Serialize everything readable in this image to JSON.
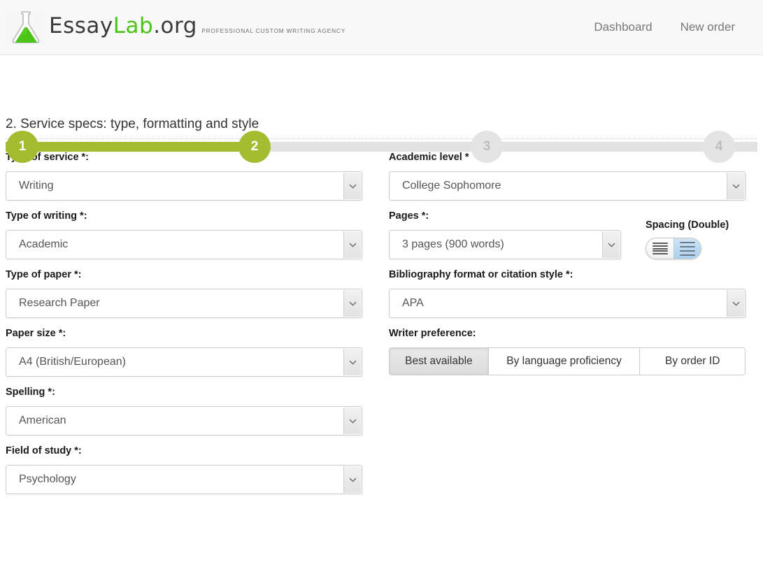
{
  "header": {
    "logo": {
      "icon": "flask-icon",
      "name_part1": "Essay",
      "name_part2": "Lab",
      "name_part3": ".org",
      "tagline": "PROFESSIONAL CUSTOM WRITING AGENCY"
    },
    "nav": [
      {
        "label": "Dashboard"
      },
      {
        "label": "New order"
      }
    ]
  },
  "stepper": {
    "steps": [
      {
        "number": "1",
        "state": "active"
      },
      {
        "number": "2",
        "state": "active"
      },
      {
        "number": "3",
        "state": "idle"
      },
      {
        "number": "4",
        "state": "idle"
      }
    ],
    "active_color": "#a4bd30",
    "idle_color": "#e4e4e4"
  },
  "section": {
    "title": "2. Service specs: type, formatting and style"
  },
  "left_column": {
    "fields": [
      {
        "label": "Type of service *:",
        "value": "Writing"
      },
      {
        "label": "Type of writing *:",
        "value": "Academic"
      },
      {
        "label": "Type of paper *:",
        "value": "Research Paper"
      },
      {
        "label": "Paper size *:",
        "value": "A4 (British/European)"
      },
      {
        "label": "Spelling *:",
        "value": "American"
      },
      {
        "label": "Field of study *:",
        "value": "Psychology"
      }
    ]
  },
  "right_column": {
    "academic_level": {
      "label": "Academic level *",
      "value": "College Sophomore"
    },
    "pages": {
      "label": "Pages *:",
      "value": "3 pages (900 words)"
    },
    "spacing": {
      "label": "Spacing (Double)",
      "option_single": "single-spacing-icon",
      "option_double": "double-spacing-icon",
      "selected": "double"
    },
    "bibliography": {
      "label": "Bibliography format or citation style *:",
      "value": "APA"
    },
    "writer_preference": {
      "label": "Writer preference:",
      "options": [
        {
          "label": "Best available",
          "selected": true
        },
        {
          "label": "By language proficiency",
          "selected": false
        },
        {
          "label": "By order ID",
          "selected": false
        }
      ]
    }
  }
}
